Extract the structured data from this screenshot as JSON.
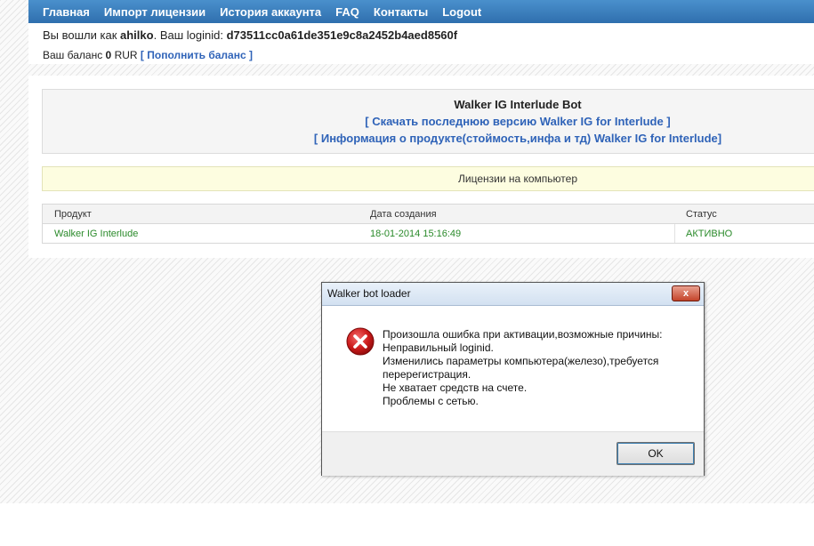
{
  "nav": {
    "items": [
      "Главная",
      "Импорт лицензии",
      "История аккаунта",
      "FAQ",
      "Контакты",
      "Logout"
    ]
  },
  "account": {
    "logged_prefix": "Вы вошли как ",
    "username": "ahilko",
    "loginid_prefix": ". Ваш loginid: ",
    "loginid": "d73511cc0a61de351e9c8a2452b4aed8560f",
    "balance_prefix": "Ваш баланс ",
    "balance": "0",
    "currency": "RUR",
    "topup_link": "[ Пополнить баланс ]"
  },
  "product_box": {
    "title": "Walker IG Interlude Bot",
    "download_link": "[ Скачать последнюю версию Walker IG for Interlude ]",
    "info_link": "[ Информация о продукте(стоймость,инфа и тд) Walker IG for Interlude]"
  },
  "licenses": {
    "heading": "Лицензии на компьютер",
    "columns": [
      "Продукт",
      "Дата создания",
      "Статус"
    ],
    "rows": [
      {
        "product": "Walker IG Interlude",
        "created": "18-01-2014 15:16:49",
        "status": "АКТИВНО"
      }
    ]
  },
  "dialog": {
    "title": "Walker bot loader",
    "close_label": "x",
    "icon": "error-icon",
    "lines": [
      "Произошла ошибка при активации,возможные причины:",
      "Неправильный loginid.",
      "Изменились параметры компьютера(железо),требуется",
      "перерегистрация.",
      "Не хватает средств на счете.",
      "Проблемы с сетью."
    ],
    "ok_label": "OK"
  },
  "colors": {
    "nav_bg": "#3a7ebd",
    "link": "#2f63b8",
    "status_green": "#2a8a2a",
    "error_red": "#c8141c"
  }
}
